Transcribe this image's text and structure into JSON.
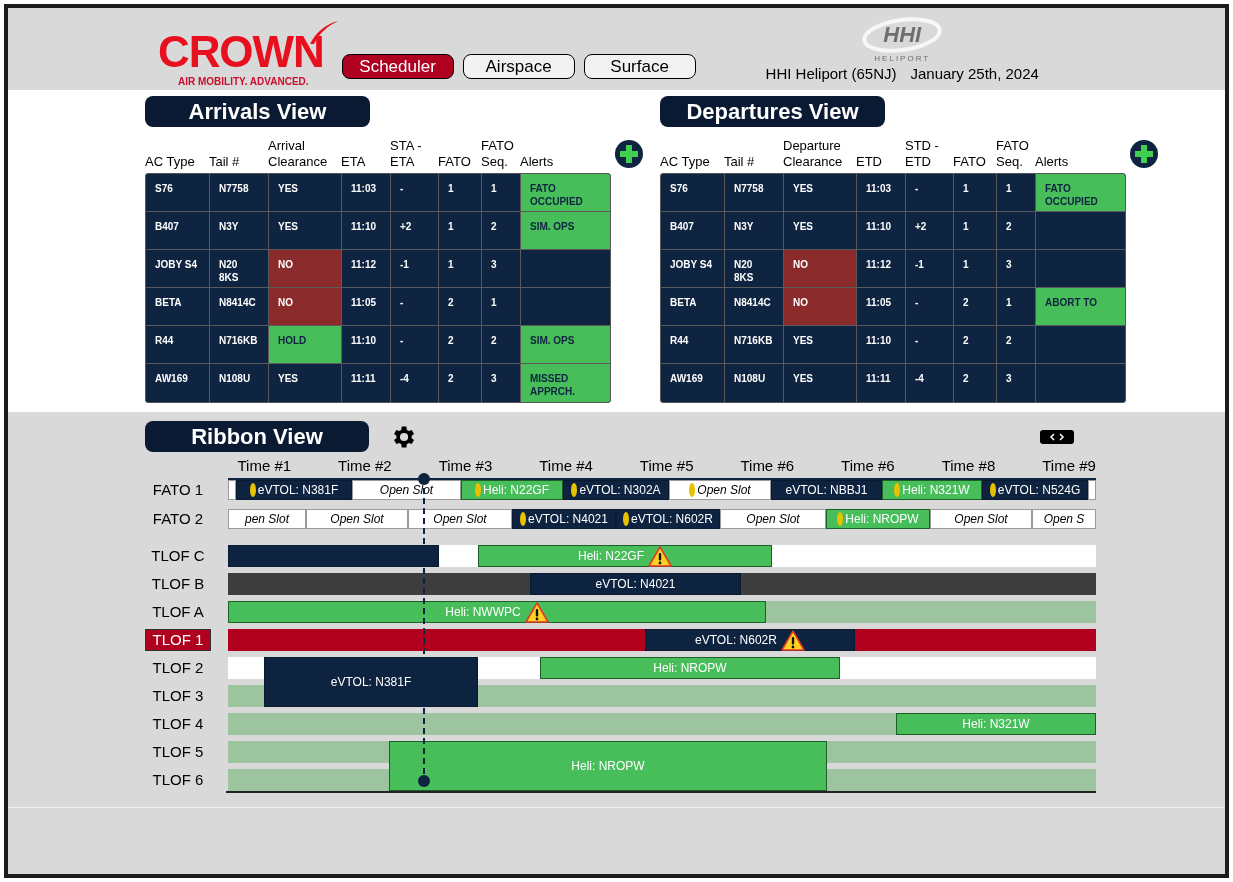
{
  "header": {
    "logo": {
      "name": "CROWN",
      "tagline": "AIR MOBILITY. ADVANCED."
    },
    "nav_tabs": [
      {
        "label": "Scheduler",
        "selected": true
      },
      {
        "label": "Airspace",
        "selected": false
      },
      {
        "label": "Surface",
        "selected": false
      }
    ],
    "partner_logo": {
      "name": "HHI",
      "subtitle": "HELIPORT"
    },
    "location": "HHI Heliport (65NJ)",
    "date": "January 25th, 2024"
  },
  "arrivals": {
    "title": "Arrivals View",
    "columns": [
      "AC Type",
      "Tail #",
      "Arrival Clearance",
      "ETA",
      "STA - ETA",
      "FATO",
      "FATO Seq.",
      "Alerts"
    ],
    "rows": [
      {
        "cells": [
          "S76",
          "N7758",
          "YES",
          "11:03",
          "-",
          "1",
          "1"
        ],
        "kind": "granted",
        "alert": "FATO OCCUPIED"
      },
      {
        "cells": [
          "B407",
          "N3Y",
          "YES",
          "11:10",
          "+2",
          "1",
          "2"
        ],
        "kind": "granted",
        "alert": "SIM. OPS"
      },
      {
        "cells": [
          "JOBY S4",
          "N20 8KS",
          "NO",
          "11:12",
          "-1",
          "1",
          "3"
        ],
        "kind": "denied"
      },
      {
        "cells": [
          "BETA",
          "N8414C",
          "NO",
          "11:05",
          "-",
          "2",
          "1"
        ],
        "kind": "denied"
      },
      {
        "cells": [
          "R44",
          "N716KB",
          "HOLD",
          "11:10",
          "-",
          "2",
          "2"
        ],
        "kind": "hold",
        "alert": "SIM. OPS"
      },
      {
        "cells": [
          "AW169",
          "N108U",
          "YES",
          "11:11",
          "-4",
          "2",
          "3"
        ],
        "kind": "granted",
        "alert": "MISSED APPRCH."
      }
    ]
  },
  "departures": {
    "title": "Departures View",
    "columns": [
      "AC Type",
      "Tail #",
      "Departure Clearance",
      "ETD",
      "STD - ETD",
      "FATO",
      "FATO Seq.",
      "Alerts"
    ],
    "rows": [
      {
        "cells": [
          "S76",
          "N7758",
          "YES",
          "11:03",
          "-",
          "1",
          "1"
        ],
        "kind": "granted",
        "alert": "FATO OCCUPIED"
      },
      {
        "cells": [
          "B407",
          "N3Y",
          "YES",
          "11:10",
          "+2",
          "1",
          "2"
        ],
        "kind": "granted"
      },
      {
        "cells": [
          "JOBY S4",
          "N20 8KS",
          "NO",
          "11:12",
          "-1",
          "1",
          "3"
        ],
        "kind": "denied"
      },
      {
        "cells": [
          "BETA",
          "N8414C",
          "NO",
          "11:05",
          "-",
          "2",
          "1"
        ],
        "kind": "denied",
        "alert": "ABORT TO"
      },
      {
        "cells": [
          "R44",
          "N716KB",
          "YES",
          "11:10",
          "-",
          "2",
          "2"
        ],
        "kind": "granted"
      },
      {
        "cells": [
          "AW169",
          "N108U",
          "YES",
          "11:11",
          "-4",
          "2",
          "3"
        ],
        "kind": "granted"
      }
    ]
  },
  "ribbon": {
    "title": "Ribbon View",
    "time_labels": [
      "Time #1",
      "Time #2",
      "Time #3",
      "Time #4",
      "Time #5",
      "Time #6",
      "Time #6",
      "Time #8",
      "Time #9"
    ],
    "fato_rows": [
      {
        "label": "FATO 1",
        "slots": [
          {
            "kind": "open"
          },
          {
            "kind": "evtol",
            "label": "eVTOL: N381F",
            "marker": true
          },
          {
            "kind": "open",
            "label": "Open Slot"
          },
          {
            "kind": "heli",
            "label": "Heli: N22GF",
            "marker": true
          },
          {
            "kind": "evtol",
            "label": "eVTOL: N302A",
            "marker": true
          },
          {
            "kind": "open",
            "label": "Open Slot",
            "marker": true
          },
          {
            "kind": "evtol",
            "label": "eVTOL: NBBJ1"
          },
          {
            "kind": "heli",
            "label": "Heli: N321W",
            "marker": true
          },
          {
            "kind": "evtol",
            "label": "eVTOL: N524G",
            "marker": true
          },
          {
            "kind": "open"
          }
        ]
      },
      {
        "label": "FATO 2",
        "slots": [
          {
            "kind": "open",
            "label": "pen Slot"
          },
          {
            "kind": "open",
            "label": "Open Slot"
          },
          {
            "kind": "open",
            "label": "Open Slot"
          },
          {
            "kind": "evtol",
            "label": "eVTOL: N4021",
            "marker": true
          },
          {
            "kind": "evtol",
            "label": "eVTOL: N602R",
            "marker": true
          },
          {
            "kind": "open",
            "label": "Open Slot"
          },
          {
            "kind": "heli",
            "label": "Heli: NROPW",
            "marker": true
          },
          {
            "kind": "open",
            "label": "Open Slot"
          },
          {
            "kind": "open",
            "label": "Open S"
          }
        ]
      }
    ],
    "tlof_rows": [
      {
        "label": "TLOF C",
        "selected": false,
        "color": "#ffffff"
      },
      {
        "label": "TLOF B",
        "selected": false,
        "color": "#3d3d3d"
      },
      {
        "label": "TLOF A",
        "selected": false,
        "color": "#9cc49e"
      },
      {
        "label": "TLOF 1",
        "selected": true,
        "color": "#b0001e"
      },
      {
        "label": "TLOF 2",
        "selected": false,
        "color": "#ffffff"
      },
      {
        "label": "TLOF 3",
        "selected": false,
        "color": "#9cc49e"
      },
      {
        "label": "TLOF 4",
        "selected": false,
        "color": "#9cc49e"
      },
      {
        "label": "TLOF 5",
        "selected": false,
        "color": "#9cc49e"
      },
      {
        "label": "TLOF 6",
        "selected": false,
        "color": "#9cc49e"
      }
    ],
    "blocks": [
      {
        "kind": "evtol",
        "alert": false
      },
      {
        "kind": "heli",
        "label": "Heli: N22GF",
        "alert": true
      },
      {
        "kind": "evtol",
        "label": "eVTOL: N4021",
        "alert": false
      },
      {
        "kind": "heli",
        "label": "Heli: NWWPC",
        "alert": true
      },
      {
        "kind": "evtol",
        "label": "eVTOL: N602R",
        "alert": true
      },
      {
        "kind": "heli",
        "label": "Heli: NROPW",
        "alert": false
      },
      {
        "kind": "evtol",
        "label": "eVTOL: N381F",
        "alert": false
      },
      {
        "kind": "heli",
        "label": "Heli: N321W",
        "alert": false
      },
      {
        "kind": "heli",
        "label": "Heli: NROPW",
        "alert": false
      }
    ]
  }
}
